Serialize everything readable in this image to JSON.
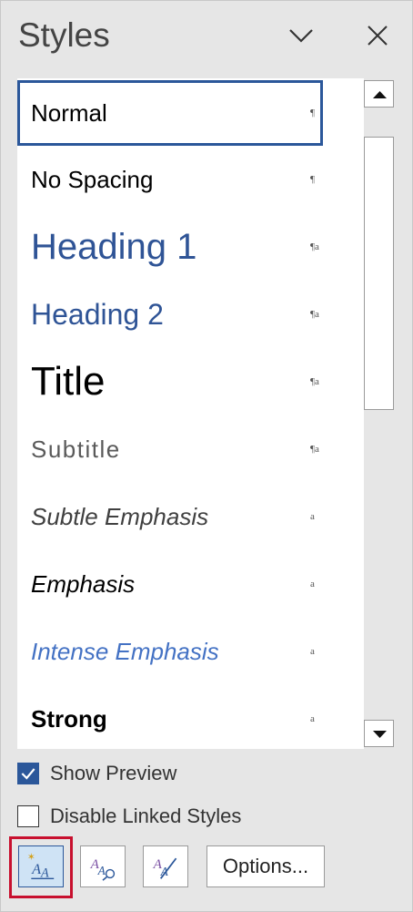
{
  "pane": {
    "title": "Styles"
  },
  "header": {
    "collapse_icon": "chevron-down-icon",
    "close_icon": "close-icon"
  },
  "styles": [
    {
      "name": "Normal",
      "mark": "¶",
      "selected": true
    },
    {
      "name": "No Spacing",
      "mark": "¶"
    },
    {
      "name": "Heading 1",
      "mark": "¶a"
    },
    {
      "name": "Heading 2",
      "mark": "¶a"
    },
    {
      "name": "Title",
      "mark": "¶a"
    },
    {
      "name": "Subtitle",
      "mark": "¶a"
    },
    {
      "name": "Subtle Emphasis",
      "mark": "a"
    },
    {
      "name": "Emphasis",
      "mark": "a"
    },
    {
      "name": "Intense Emphasis",
      "mark": "a"
    },
    {
      "name": "Strong",
      "mark": "a"
    }
  ],
  "options": {
    "show_preview": {
      "label": "Show Preview",
      "checked": true
    },
    "disable_linked": {
      "label": "Disable Linked Styles",
      "checked": false
    }
  },
  "toolbar": {
    "new_style_icon": "new-style-icon",
    "style_inspector_icon": "style-inspector-icon",
    "manage_styles_icon": "manage-styles-icon",
    "options_label": "Options..."
  },
  "colors": {
    "accent": "#2b579a",
    "heading": "#2f5496",
    "intense": "#4472c4",
    "highlight": "#c8102e"
  }
}
